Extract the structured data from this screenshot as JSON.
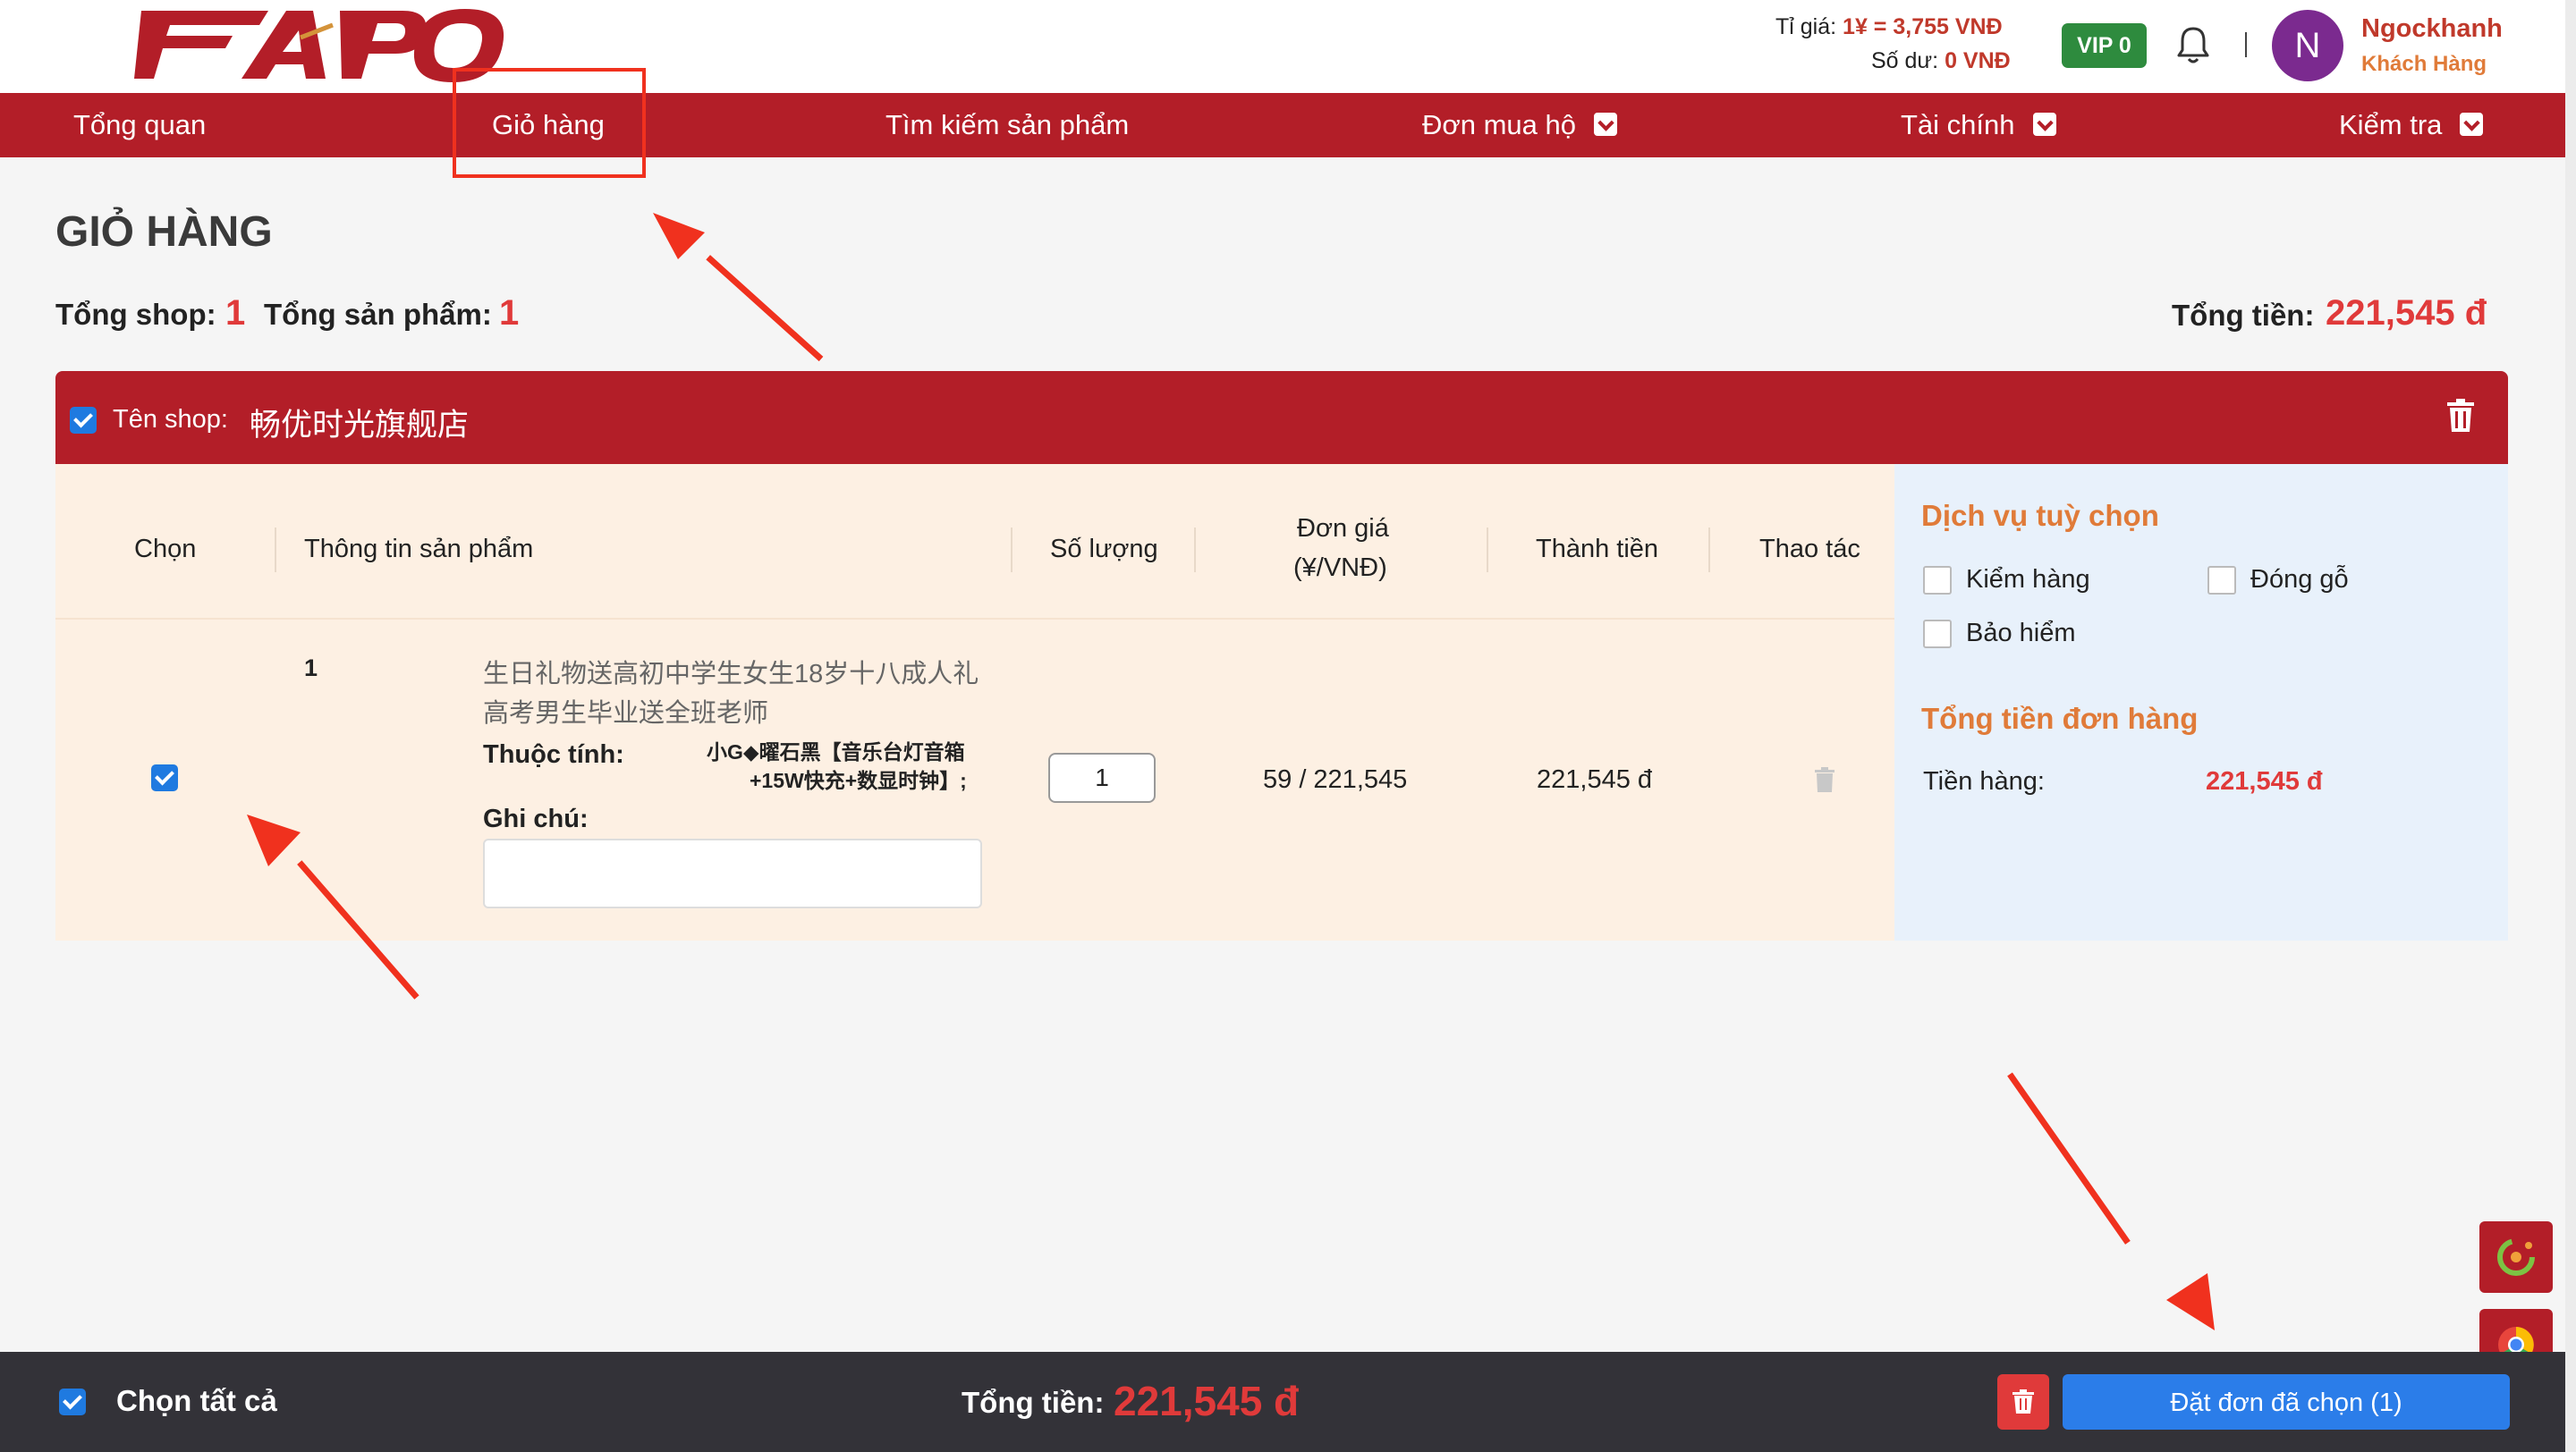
{
  "header": {
    "logo_text": "FAPO",
    "rate_label": "Tỉ giá:",
    "rate_value": "1¥ = 3,755 VNĐ",
    "balance_label": "Số dư:",
    "balance_value": "0 VNĐ",
    "vip_badge": "VIP 0",
    "avatar_letter": "N",
    "user_name": "Ngockhanh",
    "user_role": "Khách Hàng"
  },
  "nav": {
    "items": [
      {
        "label": "Tổng quan"
      },
      {
        "label": "Giỏ hàng"
      },
      {
        "label": "Tìm kiếm sản phẩm"
      },
      {
        "label": "Đơn mua hộ"
      },
      {
        "label": "Tài chính"
      },
      {
        "label": "Kiểm tra"
      }
    ]
  },
  "page": {
    "title": "GIỎ HÀNG",
    "total_shop_label": "Tổng shop:",
    "total_shop_value": "1",
    "total_products_label": "Tổng sản phẩm:",
    "total_products_value": "1",
    "total_money_label": "Tổng tiền:",
    "total_money_value": "221,545 đ"
  },
  "shop": {
    "name_label": "Tên shop:",
    "name": "畅优时光旗舰店"
  },
  "table": {
    "headers": {
      "select": "Chọn",
      "product": "Thông tin sản phẩm",
      "quantity": "Số lượng",
      "unit_price_line1": "Đơn giá",
      "unit_price_line2": "(¥/VNĐ)",
      "total": "Thành tiền",
      "action": "Thao tác"
    },
    "rows": [
      {
        "index": "1",
        "title_line1": "生日礼物送高初中学生女生18岁十八成人礼",
        "title_line2": "高考男生毕业送全班老师",
        "attr_label": "Thuộc tính:",
        "attr_line1": "小G◆曜石黑【音乐台灯音箱",
        "attr_line2": "+15W快充+数显时钟】;",
        "note_label": "Ghi chú:",
        "note_value": "",
        "quantity": "1",
        "unit_price": "59 / 221,545",
        "total": "221,545 đ"
      }
    ]
  },
  "services": {
    "title": "Dịch vụ tuỳ chọn",
    "options": [
      {
        "label": "Kiểm hàng",
        "checked": false
      },
      {
        "label": "Đóng gỗ",
        "checked": false
      },
      {
        "label": "Bảo hiểm",
        "checked": false
      }
    ],
    "summary_title": "Tổng tiền đơn hàng",
    "goods_label": "Tiền hàng:",
    "goods_value": "221,545 đ"
  },
  "footer": {
    "select_all_label": "Chọn tất cả",
    "total_label": "Tổng tiền:",
    "total_value": "221,545 đ",
    "order_button": "Đặt đơn đã chọn (1)"
  },
  "colors": {
    "brand_red": "#b31e28",
    "accent_orange": "#e07b39",
    "price_red": "#e03a3a",
    "primary_blue": "#2b7de9",
    "annotation_red": "#f0311e"
  }
}
